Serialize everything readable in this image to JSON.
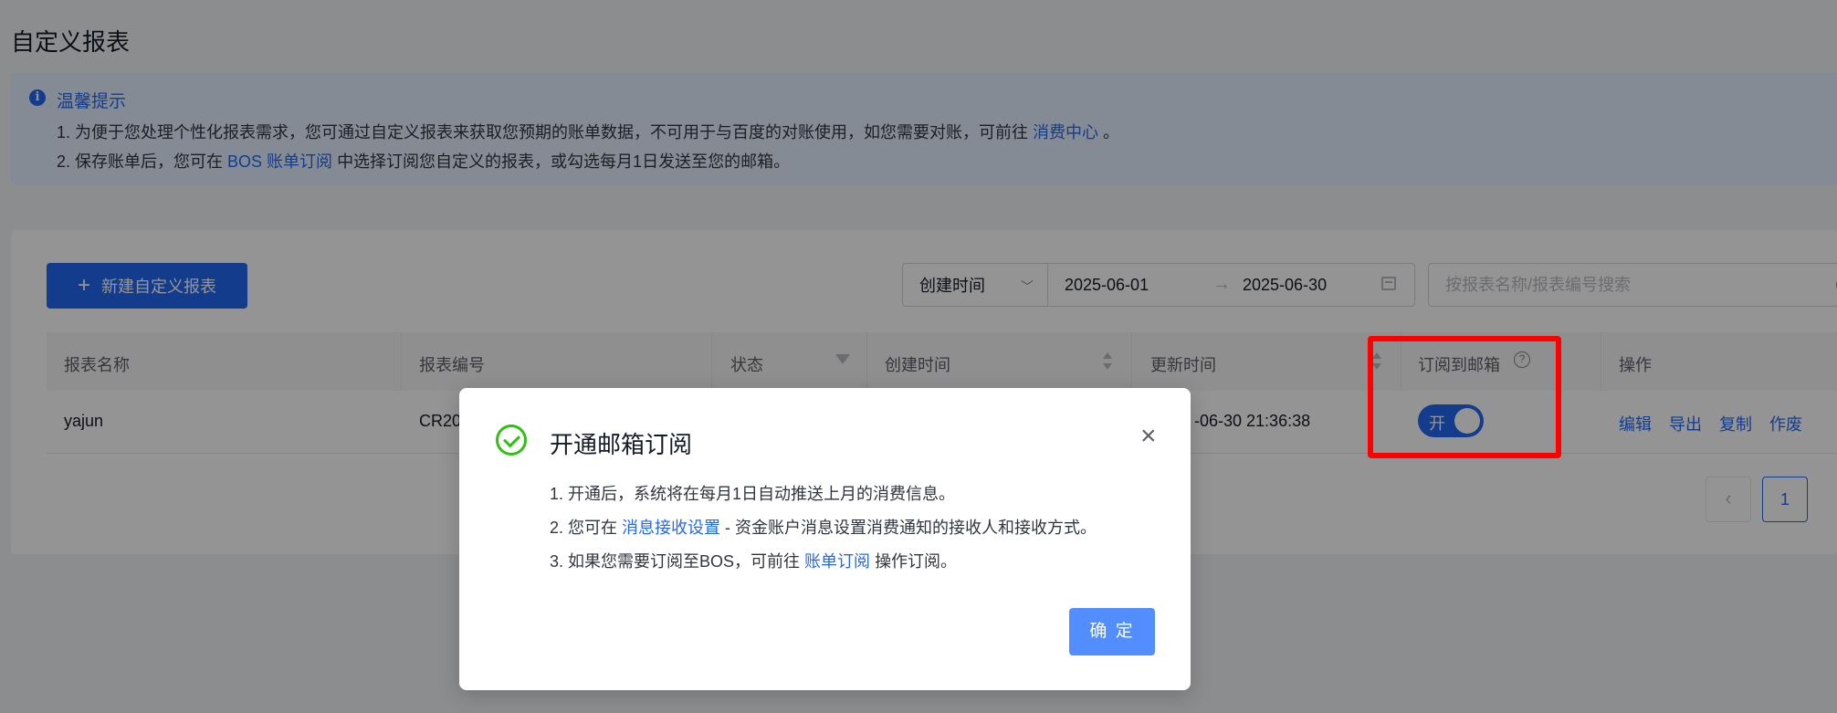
{
  "page": {
    "title": "自定义报表"
  },
  "notice": {
    "title": "温馨提示",
    "line1_prefix": "1. 为便于您处理个性化报表需求，您可通过自定义报表来获取您预期的账单数据，不可用于与百度的对账使用，如您需要对账，可前往",
    "line1_link": "消费中心",
    "line1_suffix": "。",
    "line2_prefix": "2. 保存账单后，您可在",
    "line2_link": "BOS 账单订阅",
    "line2_suffix": "中选择订阅您自定义的报表，或勾选每月1日发送至您的邮箱。"
  },
  "toolbar": {
    "new_button": "新建自定义报表",
    "filter_field": "创建时间",
    "date_start": "2025-06-01",
    "date_end": "2025-06-30",
    "search_placeholder": "按报表名称/报表编号搜索"
  },
  "table": {
    "headers": {
      "name": "报表名称",
      "code": "报表编号",
      "status": "状态",
      "created": "创建时间",
      "updated": "更新时间",
      "subscribe": "订阅到邮箱",
      "actions": "操作"
    },
    "rows": [
      {
        "name": "yajun",
        "code": "CR20",
        "updated": "-06-30 21:36:38",
        "toggle_label": "开",
        "actions": [
          "编辑",
          "导出",
          "复制",
          "作废"
        ]
      }
    ]
  },
  "pagination": {
    "prev": "‹",
    "current": "1"
  },
  "modal": {
    "title": "开通邮箱订阅",
    "close": "×",
    "line1": "1. 开通后，系统将在每月1日自动推送上月的消费信息。",
    "line2_prefix": "2. 您可在",
    "line2_link": "消息接收设置",
    "line2_suffix": "- 资金账户消息设置消费通知的接收人和接收方式。",
    "line3_prefix": "3. 如果您需要订阅至BOS，可前往",
    "line3_link": "账单订阅",
    "line3_suffix": "操作订阅。",
    "confirm": "确 定"
  },
  "colors": {
    "primary": "#2468f2",
    "success": "#30bf13",
    "highlight": "#ff0000"
  }
}
